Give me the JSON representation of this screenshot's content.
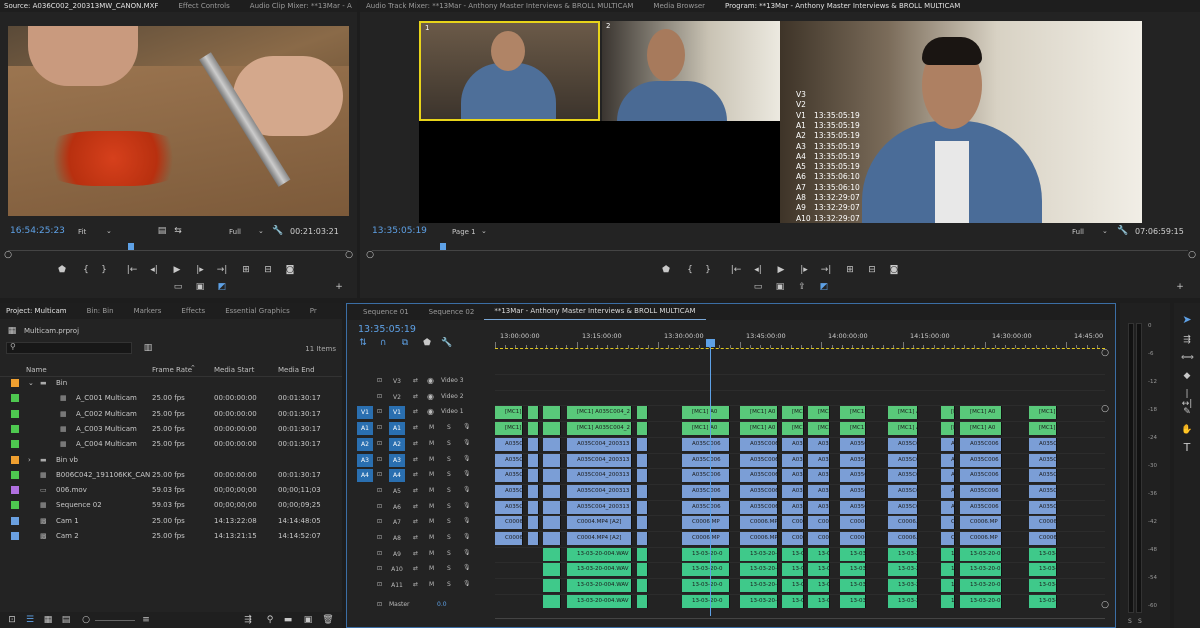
{
  "source": {
    "tabs": [
      "Source: A036C002_200313MW_CANON.MXF",
      "Effect Controls",
      "Audio Clip Mixer: **13Mar - A"
    ],
    "timecode": "16:54:25:23",
    "fit": "Fit",
    "quality": "Full",
    "duration": "00:21:03:21"
  },
  "program": {
    "tabs": [
      "Audio Track Mixer: **13Mar - Anthony Master Interviews & BROLL MULTICAM",
      "Media Browser",
      "Program: **13Mar - Anthony Master Interviews & BROLL MULTICAM"
    ],
    "timecode": "13:35:05:19",
    "page": "Page 1",
    "quality": "Full",
    "duration": "07:06:59:15",
    "cam1_label": "1",
    "cam2_label": "2",
    "track_overlay": [
      {
        "t": "V3",
        "v": ""
      },
      {
        "t": "V2",
        "v": ""
      },
      {
        "t": "V1",
        "v": "13:35:05:19"
      },
      {
        "t": "A1",
        "v": "13:35:05:19"
      },
      {
        "t": "A2",
        "v": "13:35:05:19"
      },
      {
        "t": "A3",
        "v": "13:35:05:19"
      },
      {
        "t": "A4",
        "v": "13:35:05:19"
      },
      {
        "t": "A5",
        "v": "13:35:05:19"
      },
      {
        "t": "A6",
        "v": "13:35:06:10"
      },
      {
        "t": "A7",
        "v": "13:35:06:10"
      },
      {
        "t": "A8",
        "v": "13:32:29:07"
      },
      {
        "t": "A9",
        "v": "13:32:29:07"
      },
      {
        "t": "A10",
        "v": "13:32:29:07"
      }
    ]
  },
  "project": {
    "tabs": [
      "Project: Multicam",
      "Bin: Bin",
      "Markers",
      "Effects",
      "Essential Graphics",
      "Pr"
    ],
    "file": "Multicam.prproj",
    "count": "11 Items",
    "headers": {
      "name": "Name",
      "rate": "Frame Rate",
      "start": "Media Start",
      "end": "Media End"
    },
    "rows": [
      {
        "color": "#f0a030",
        "indent": 0,
        "kind": "folder",
        "name": "Bin",
        "rate": "",
        "start": "",
        "end": "",
        "arrow": "⌄"
      },
      {
        "color": "#4ec850",
        "indent": 1,
        "kind": "seq",
        "name": "A_C001 Multicam",
        "rate": "25.00 fps",
        "start": "00:00:00:00",
        "end": "00:01:30:17",
        "arrow": ""
      },
      {
        "color": "#4ec850",
        "indent": 1,
        "kind": "seq",
        "name": "A_C002 Multicam",
        "rate": "25.00 fps",
        "start": "00:00:00:00",
        "end": "00:01:30:17",
        "arrow": ""
      },
      {
        "color": "#4ec850",
        "indent": 1,
        "kind": "seq",
        "name": "A_C003 Multicam",
        "rate": "25.00 fps",
        "start": "00:00:00:00",
        "end": "00:01:30:17",
        "arrow": ""
      },
      {
        "color": "#4ec850",
        "indent": 1,
        "kind": "seq",
        "name": "A_C004 Multicam",
        "rate": "25.00 fps",
        "start": "00:00:00:00",
        "end": "00:01:30:17",
        "arrow": ""
      },
      {
        "color": "#f0a030",
        "indent": 0,
        "kind": "folder",
        "name": "Bin vb",
        "rate": "",
        "start": "",
        "end": "",
        "arrow": "›"
      },
      {
        "color": "#4ec850",
        "indent": 0,
        "kind": "seq",
        "name": "B006C042_191106KK_CAN",
        "rate": "25.00 fps",
        "start": "00:00:00:00",
        "end": "00:01:30:17",
        "arrow": ""
      },
      {
        "color": "#b070e0",
        "indent": 0,
        "kind": "file",
        "name": "006.mov",
        "rate": "59.03 fps",
        "start": "00;00;00;00",
        "end": "00;00;11;03",
        "arrow": ""
      },
      {
        "color": "#4ec850",
        "indent": 0,
        "kind": "seq",
        "name": "Sequence 02",
        "rate": "59.03 fps",
        "start": "00;00;00;00",
        "end": "00;00;09;25",
        "arrow": ""
      },
      {
        "color": "#6aa0e0",
        "indent": 0,
        "kind": "clip",
        "name": "Cam 1",
        "rate": "25.00 fps",
        "start": "14:13:22:08",
        "end": "14:14:48:05",
        "arrow": ""
      },
      {
        "color": "#6aa0e0",
        "indent": 0,
        "kind": "clip",
        "name": "Cam 2",
        "rate": "25.00 fps",
        "start": "14:13:21:15",
        "end": "14:14:52:07",
        "arrow": ""
      }
    ]
  },
  "timeline": {
    "tabs": [
      "Sequence 01",
      "Sequence 02",
      "**13Mar - Anthony Master Interviews & BROLL MULTICAM"
    ],
    "timecode": "13:35:05:19",
    "ruler": [
      "13:00:00:00",
      "13:15:00:00",
      "13:30:00:00",
      "13:45:00:00",
      "14:00:00:00",
      "14:15:00:00",
      "14:30:00:00",
      "14:45:00"
    ],
    "video_tracks": [
      {
        "src": "",
        "id": "V3",
        "name": "Video 3"
      },
      {
        "src": "",
        "id": "V2",
        "name": "Video 2"
      },
      {
        "src": "V1",
        "id": "V1",
        "name": "Video 1"
      }
    ],
    "audio_tracks": [
      {
        "src": "A1",
        "id": "A1"
      },
      {
        "src": "A2",
        "id": "A2"
      },
      {
        "src": "A3",
        "id": "A3"
      },
      {
        "src": "A4",
        "id": "A4"
      },
      {
        "src": "",
        "id": "A5"
      },
      {
        "src": "",
        "id": "A6"
      },
      {
        "src": "",
        "id": "A7"
      },
      {
        "src": "",
        "id": "A8"
      },
      {
        "src": "",
        "id": "A9"
      },
      {
        "src": "",
        "id": "A10"
      },
      {
        "src": "",
        "id": "A11"
      }
    ],
    "master_label": "Master",
    "master_value": "0.0",
    "m": "M",
    "s": "S",
    "clip_labels": {
      "v1_main": "[MC1] A035C004_2",
      "v1_short": "[MC1] A0",
      "a1_main": "[MC1] A035C004_2",
      "a_main": "A035C004_200313",
      "a_short": "A035C006",
      "a6_main": "C0004.MP4 [A2]",
      "a6_short": "C0006.MP",
      "wav_main": "13-03-20-004.WAV",
      "wav_short": "13-03-20-0"
    }
  },
  "meter": {
    "scale": [
      "0",
      "-6",
      "-12",
      "-18",
      "-24",
      "-30",
      "-36",
      "-42",
      "-48",
      "-54",
      "-60"
    ],
    "bottom": [
      "S",
      "S"
    ]
  }
}
